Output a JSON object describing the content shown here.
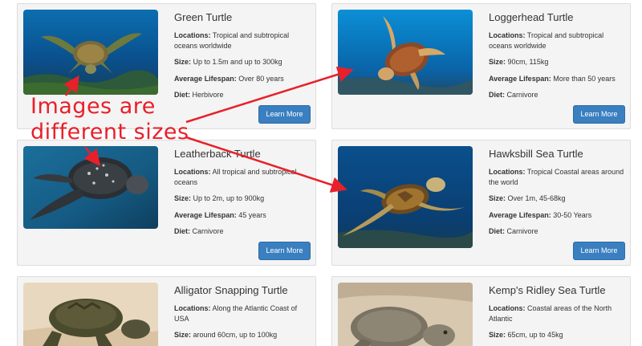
{
  "labels": {
    "locations": "Locations:",
    "size": "Size:",
    "lifespan": "Average Lifespan:",
    "diet": "Diet:"
  },
  "cards": [
    {
      "title": "Green Turtle",
      "locations": "Tropical and subtropical oceans worldwide",
      "size": "Up to 1.5m and up to 300kg",
      "lifespan": "Over 80 years",
      "diet": "Herbivore",
      "button": "Learn More"
    },
    {
      "title": "Loggerhead Turtle",
      "locations": "Tropical and subtropical oceans worldwide",
      "size": "90cm, 115kg",
      "lifespan": "More than 50 years",
      "diet": "Carnivore",
      "button": "Learn More"
    },
    {
      "title": "Leatherback Turtle",
      "locations": "All tropical and subtropical oceans",
      "size": "Up to 2m, up to 900kg",
      "lifespan": "45 years",
      "diet": "Carnivore",
      "button": "Learn More"
    },
    {
      "title": "Hawksbill Sea Turtle",
      "locations": "Tropical Coastal areas around the world",
      "size": "Over 1m, 45-68kg",
      "lifespan": "30-50 Years",
      "diet": "Carnivore",
      "button": "Learn More"
    },
    {
      "title": "Alligator Snapping Turtle",
      "locations": "Along the Atlantic Coast of USA",
      "size": "around 60cm, up to 100kg"
    },
    {
      "title": "Kemp's Ridley Sea Turtle",
      "locations": "Coastal areas of the North Atlantic",
      "size": "65cm, up to 45kg"
    }
  ],
  "annotation": {
    "line1": "Images are",
    "line2": "different sizes",
    "color": "#e8202a"
  },
  "colors": {
    "button": "#3a7fc0",
    "card_bg": "#f4f4f4"
  },
  "icons": [
    "green-turtle-photo",
    "loggerhead-turtle-photo",
    "leatherback-turtle-photo",
    "hawksbill-turtle-photo",
    "alligator-snapping-turtle-photo",
    "kemps-ridley-turtle-photo"
  ]
}
